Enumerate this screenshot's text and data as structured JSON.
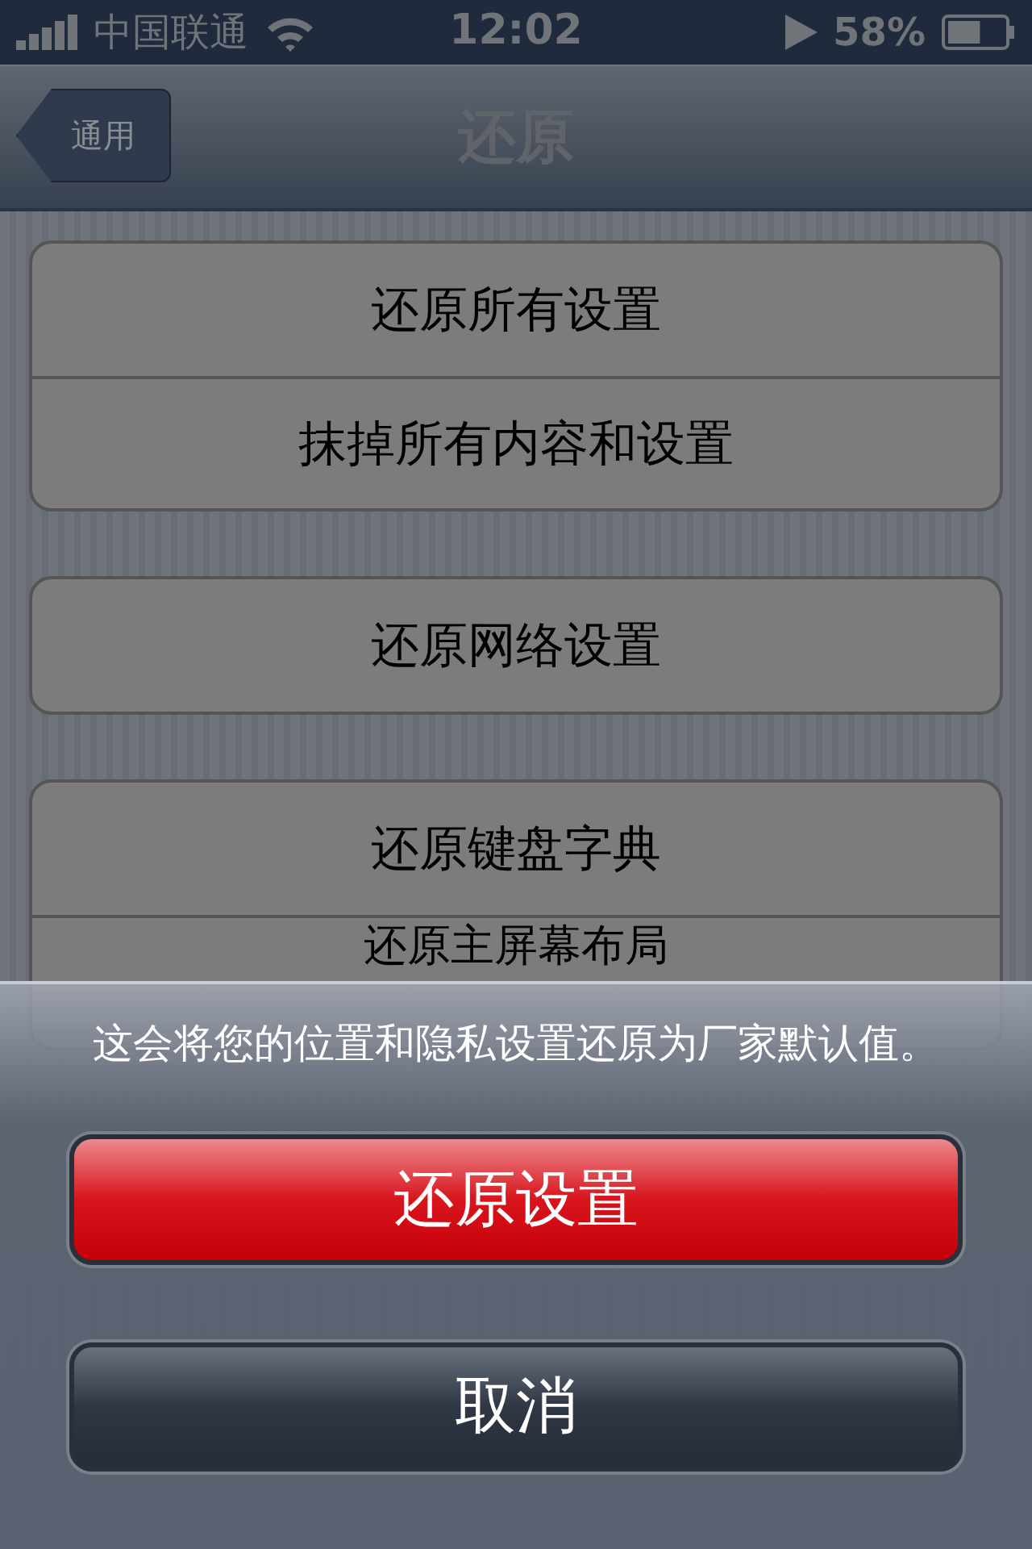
{
  "status_bar": {
    "carrier": "中国联通",
    "time": "12:02",
    "battery": "58%"
  },
  "nav": {
    "back": "通用",
    "title": "还原"
  },
  "groups": [
    {
      "rows": [
        "还原所有设置",
        "抹掉所有内容和设置"
      ]
    },
    {
      "rows": [
        "还原网络设置"
      ]
    },
    {
      "rows": [
        "还原键盘字典",
        "还原主屏幕布局"
      ]
    }
  ],
  "sheet": {
    "message": "这会将您的位置和隐私设置还原为厂家默认值。",
    "buttons": [
      {
        "label": "还原设置",
        "kind": "destructive"
      },
      {
        "label": "取消",
        "kind": "cancel"
      }
    ]
  }
}
